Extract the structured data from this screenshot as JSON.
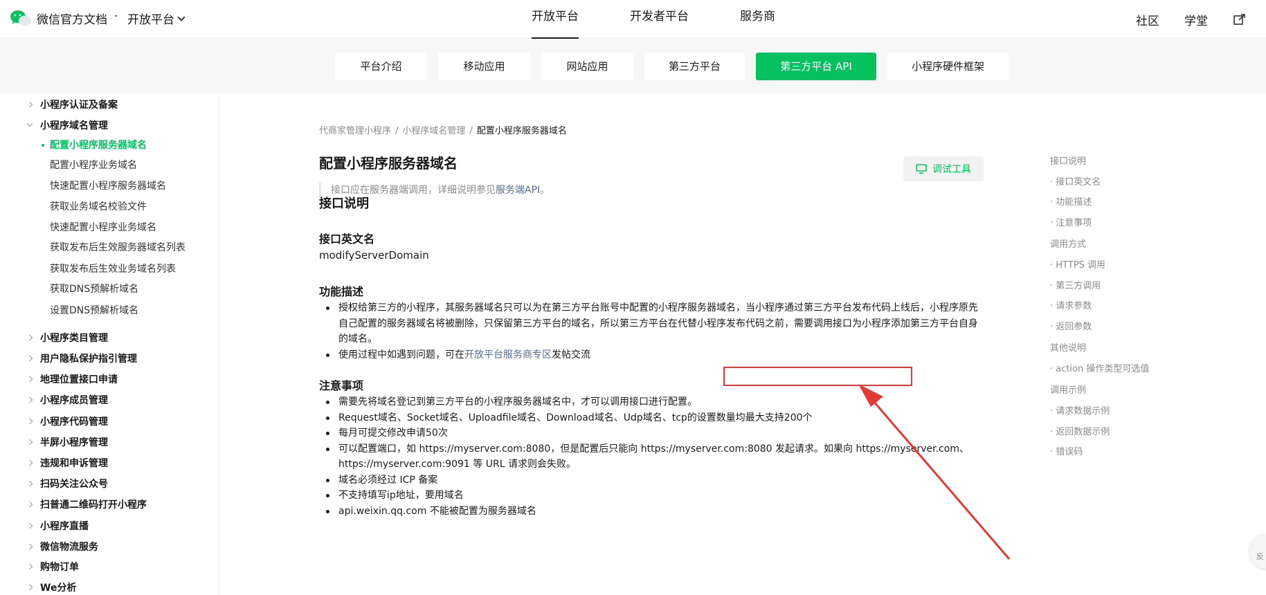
{
  "header": {
    "brand": "微信官方文档",
    "brand_dot": "·",
    "brand_sub": "开放平台",
    "nav": [
      "开放平台",
      "开发者平台",
      "服务商"
    ],
    "right": [
      "社区",
      "学堂"
    ]
  },
  "subnav": {
    "tabs": [
      "平台介绍",
      "移动应用",
      "网站应用",
      "第三方平台",
      "第三方平台 API",
      "小程序硬件框架"
    ]
  },
  "sidebar": {
    "items": [
      {
        "label": "小程序认证及备案",
        "type": "group"
      },
      {
        "label": "小程序域名管理",
        "type": "group-open"
      },
      {
        "label": "配置小程序服务器域名",
        "type": "sub-active"
      },
      {
        "label": "配置小程序业务域名",
        "type": "sub"
      },
      {
        "label": "快速配置小程序服务器域名",
        "type": "sub"
      },
      {
        "label": "获取业务域名校验文件",
        "type": "sub"
      },
      {
        "label": "快速配置小程序业务域名",
        "type": "sub"
      },
      {
        "label": "获取发布后生效服务器域名列表",
        "type": "sub"
      },
      {
        "label": "获取发布后生效业务域名列表",
        "type": "sub"
      },
      {
        "label": "获取DNS预解析域名",
        "type": "sub"
      },
      {
        "label": "设置DNS预解析域名",
        "type": "sub"
      },
      {
        "label": "小程序类目管理",
        "type": "group"
      },
      {
        "label": "用户隐私保护指引管理",
        "type": "group"
      },
      {
        "label": "地理位置接口申请",
        "type": "group"
      },
      {
        "label": "小程序成员管理",
        "type": "group"
      },
      {
        "label": "小程序代码管理",
        "type": "group"
      },
      {
        "label": "半屏小程序管理",
        "type": "group"
      },
      {
        "label": "违规和申诉管理",
        "type": "group"
      },
      {
        "label": "扫码关注公众号",
        "type": "group"
      },
      {
        "label": "扫普通二维码打开小程序",
        "type": "group"
      },
      {
        "label": "小程序直播",
        "type": "group"
      },
      {
        "label": "微信物流服务",
        "type": "group"
      },
      {
        "label": "购物订单",
        "type": "group"
      },
      {
        "label": "We分析",
        "type": "group"
      }
    ]
  },
  "content": {
    "breadcrumb": [
      "代商家管理小程序",
      "小程序域名管理",
      "配置小程序服务器域名"
    ],
    "breadcrumb_sep": "/",
    "title": "配置小程序服务器域名",
    "debug_label": "调试工具",
    "note_prefix": "接口应在服务器端调用，详细说明参见",
    "note_link": "服务端API",
    "note_suffix": "。",
    "section_desc": "接口说明",
    "en_name_title": "接口英文名",
    "en_name": "modifyServerDomain",
    "func_title": "功能描述",
    "func_items": [
      "授权给第三方的小程序，其服务器域名只可以为在第三方平台账号中配置的小程序服务器域名，当小程序通过第三方平台发布代码上线后，小程序原先自己配置的服务器域名将被删除，只保留第三方平台的域名，所以第三方平台在代替小程序发布代码之前，需要调用接口为小程序添加第三方平台自身的域名。"
    ],
    "func_item2_prefix": "使用过程中如遇到问题，可在",
    "func_item2_link": "开放平台服务商专区",
    "func_item2_suffix": "发帖交流",
    "notes_title": "注意事项",
    "notes": [
      "需要先将域名登记到第三方平台的小程序服务器域名中，才可以调用接口进行配置。",
      "Request域名、Socket域名、Uploadfile域名、Download域名、Udp域名、tcp的设置数量均最大支持200个",
      "每月可提交修改申请50次",
      "可以配置端口，如 https://myserver.com:8080，但是配置后只能向 https://myserver.com:8080 发起请求。如果向 https://myserver.com、https://myserver.com:9091 等 URL 请求则会失败。",
      "域名必须经过 ICP 备案",
      "不支持填写ip地址，要用域名",
      "api.weixin.qq.com 不能被配置为服务器域名"
    ]
  },
  "toc": [
    {
      "label": "接口说明",
      "level": 1
    },
    {
      "label": "· 接口英文名",
      "level": 2
    },
    {
      "label": "· 功能描述",
      "level": 2
    },
    {
      "label": "· 注意事项",
      "level": 2
    },
    {
      "label": "调用方式",
      "level": 1
    },
    {
      "label": "· HTTPS 调用",
      "level": 2
    },
    {
      "label": "· 第三方调用",
      "level": 2
    },
    {
      "label": "· 请求参数",
      "level": 2
    },
    {
      "label": "· 返回参数",
      "level": 2
    },
    {
      "label": "其他说明",
      "level": 1
    },
    {
      "label": "· action 操作类型可选值",
      "level": 2
    },
    {
      "label": "调用示例",
      "level": 1
    },
    {
      "label": "· 请求数据示例",
      "level": 2
    },
    {
      "label": "· 返回数据示例",
      "level": 2
    },
    {
      "label": "· 错误码",
      "level": 2
    }
  ],
  "float_btn": "反",
  "colors": {
    "accent": "#07c160",
    "link": "#576b95",
    "annotation": "#e53935"
  }
}
